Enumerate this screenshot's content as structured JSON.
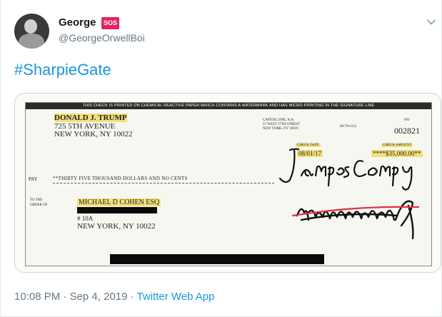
{
  "user": {
    "display_name": "George",
    "badge": "SOS",
    "handle": "@GeorgeOrwellBoi"
  },
  "tweet": {
    "text": "#SharpieGate"
  },
  "check": {
    "banner": "THIS CHECK IS PRINTED ON CHEMICAL REACTIVE PAPER WHICH CONTAINS A WATERMARK AND HAS MICRO PRINTING IN THE SIGNATURE LINE",
    "payer_name": "DONALD J. TRUMP",
    "payer_address_line1": "725 5TH AVENUE",
    "payer_address_line2": "NEW YORK, NY 10022",
    "bank_line1": "CAPITAL ONE, N.A.",
    "bank_line2": "57 WEST 57TH STREET",
    "bank_line3": "NEW YORK, NY 10019",
    "routing": "60-791/214",
    "check_no_label": "NO.",
    "check_number": "002821",
    "date_label": "CHECK DATE",
    "date": "08/01/17",
    "amount_label": "CHECK AMOUNT",
    "amount": "****$35,000.00**",
    "pay_label": "PAY",
    "pay_words": "**THIRTY FIVE THOUSAND DOLLARS AND NO CENTS",
    "order_label_line1": "TO THE",
    "order_label_line2": "ORDER OF",
    "payee": "MICHAEL D COHEN ESQ",
    "payee_apt": "# 10A",
    "payee_city": "NEW YORK, NY 10022",
    "handwritten_name": "James Comey"
  },
  "footer": {
    "time": "10:08 PM",
    "date": "Sep 4, 2019",
    "app": "Twitter Web App",
    "separator": "·"
  },
  "colors": {
    "accent": "#1b95e0",
    "muted": "#657786",
    "badge": "#e0245e",
    "highlight": "#f3e07a",
    "strike": "#e0304a"
  },
  "icons": [
    "chevron-down-icon",
    "avatar"
  ]
}
